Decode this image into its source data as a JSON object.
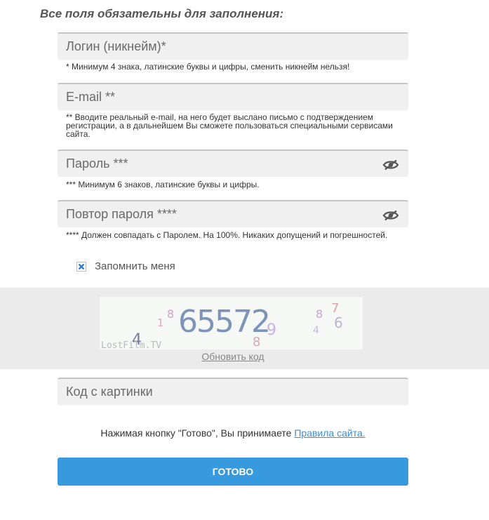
{
  "form": {
    "heading": "Все поля обязательны для заполнения:",
    "login": {
      "placeholder": "Логин (никнейм)*",
      "value": "",
      "hint": "* Минимум 4 знака, латинские буквы и цифры, сменить никнейм нельзя!"
    },
    "email": {
      "placeholder": "E-mail **",
      "value": "",
      "hint": "** Вводите реальный e-mail, на него будет выслано письмо с подтверждением регистрации, а в дальнейшем Вы сможете пользоваться специальными сервисами сайта."
    },
    "password": {
      "placeholder": "Пароль ***",
      "value": "",
      "hint": "*** Минимум 6 знаков, латинские буквы и цифры.",
      "toggle_icon": "eye-off-icon"
    },
    "password_repeat": {
      "placeholder": "Повтор пароля ****",
      "value": "",
      "hint": "**** Должен совпадать с Паролем. На 100%. Никаких допущений и погрешностей.",
      "toggle_icon": "eye-off-icon"
    },
    "remember": {
      "label": "Запомнить меня",
      "checked": true
    },
    "captcha": {
      "code": "65572",
      "noise_digits": [
        "1",
        "8",
        "4",
        "8",
        "9",
        "8",
        "7",
        "6",
        "4"
      ],
      "watermark": "LostFilm.TV",
      "refresh_label": "Обновить код"
    },
    "captcha_input": {
      "placeholder": "Код с картинки",
      "value": ""
    },
    "terms": {
      "text": "Нажимая кнопку \"Готово\", Вы принимаете ",
      "link": "Правила сайта."
    },
    "submit_label": "Готово",
    "colors": {
      "accent": "#3799de",
      "link": "#3a90d0",
      "field_bg": "#f0f0f0",
      "band_bg": "#ebebeb"
    }
  }
}
